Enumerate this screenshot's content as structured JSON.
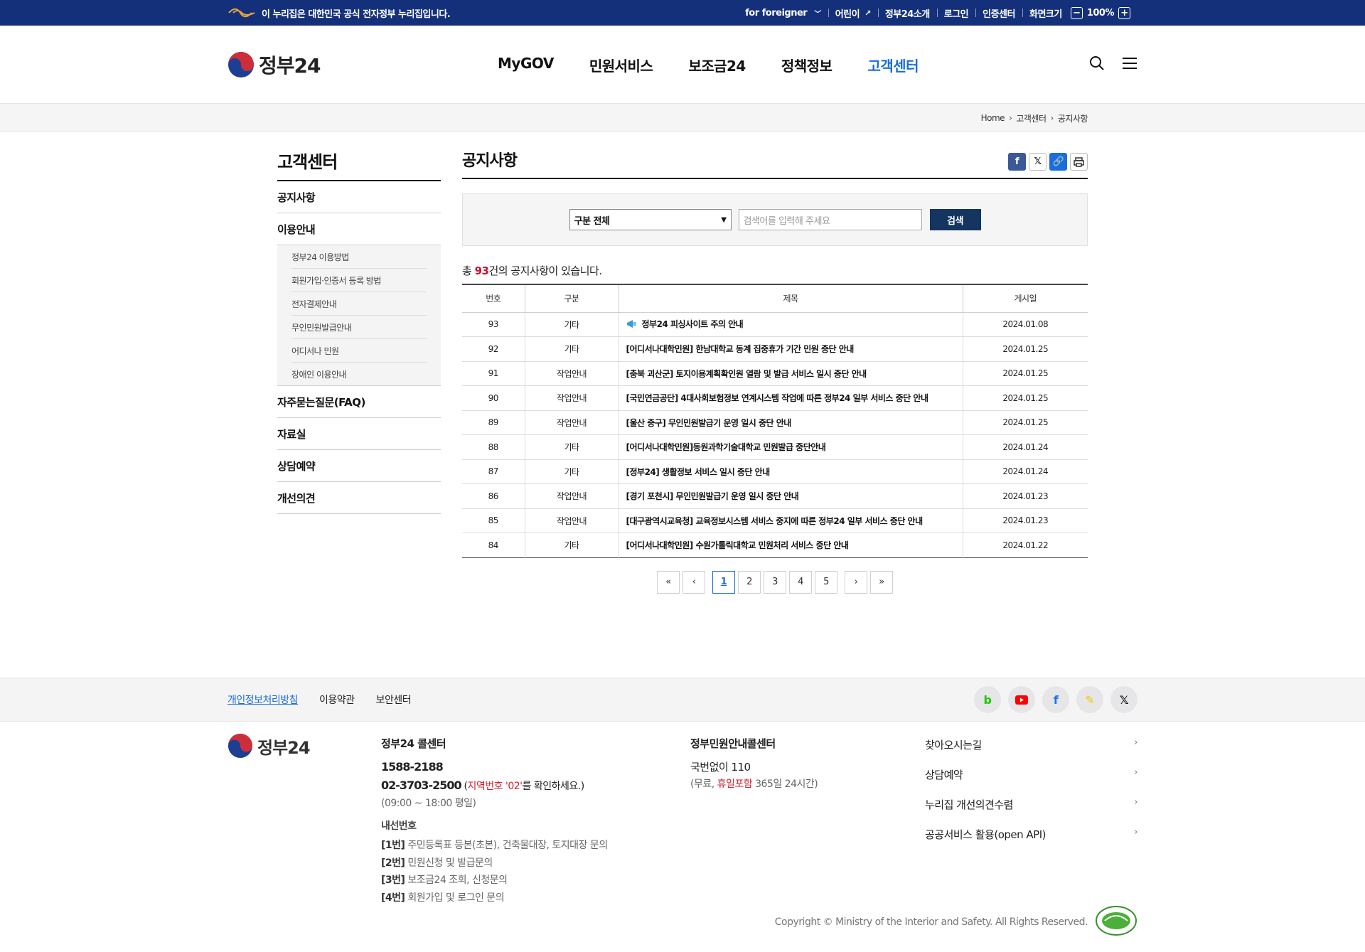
{
  "gov_bar": {
    "notice": "이 누리집은 대한민국 공식 전자정부 누리집입니다.",
    "links": [
      "for foreigner",
      "어린이",
      "정부24소개",
      "로그인",
      "인증센터",
      "화면크기"
    ],
    "zoom": "100%"
  },
  "header": {
    "logo": "정부24",
    "nav": [
      "MyGOV",
      "민원서비스",
      "보조금24",
      "정책정보",
      "고객센터"
    ]
  },
  "breadcrumb": [
    "Home",
    "고객센터",
    "공지사항"
  ],
  "lnb": {
    "title": "고객센터",
    "items": {
      "notice": "공지사항",
      "guide": "이용안내",
      "faq": "자주묻는질문(FAQ)",
      "archive": "자료실",
      "consult": "상담예약",
      "improve": "개선의견"
    },
    "sub": [
      "정부24 이용방법",
      "회원가입·인증서 등록 방법",
      "전자결제안내",
      "무인민원발급안내",
      "어디서나 민원",
      "장애인 이용안내"
    ]
  },
  "main": {
    "title": "공지사항",
    "search": {
      "select": "구분 전체",
      "placeholder": "검색어를 입력해 주세요",
      "button": "검색"
    },
    "total_prefix": "총 ",
    "total": "93",
    "total_suffix": "건의 공지사항이 있습니다.",
    "columns": [
      "번호",
      "구분",
      "제목",
      "게시일"
    ],
    "rows": [
      {
        "no": "93",
        "cat": "기타",
        "title": "정부24 피싱사이트 주의 안내",
        "date": "2024.01.08"
      },
      {
        "no": "92",
        "cat": "기타",
        "title": "[어디서나대학민원] 한남대학교 동계 집중휴가 기간 민원 중단 안내",
        "date": "2024.01.25"
      },
      {
        "no": "91",
        "cat": "작업안내",
        "title": "[충북 괴산군] 토지이용계획확인원 열람 및 발급 서비스 일시 중단 안내",
        "date": "2024.01.25"
      },
      {
        "no": "90",
        "cat": "작업안내",
        "title": "[국민연금공단] 4대사회보험정보 연계시스템 작업에 따른 정부24 일부 서비스 중단 안내",
        "date": "2024.01.25"
      },
      {
        "no": "89",
        "cat": "작업안내",
        "title": "[울산 중구] 무인민원발급기 운영 일시 중단 안내",
        "date": "2024.01.25"
      },
      {
        "no": "88",
        "cat": "기타",
        "title": "[어디서나대학민원]동원과학기술대학교 민원발급 중단안내",
        "date": "2024.01.24"
      },
      {
        "no": "87",
        "cat": "기타",
        "title": "[정부24] 생활정보 서비스 일시 중단 안내",
        "date": "2024.01.24"
      },
      {
        "no": "86",
        "cat": "작업안내",
        "title": "[경기 포천시] 무인민원발급기 운영 일시 중단 안내",
        "date": "2024.01.23"
      },
      {
        "no": "85",
        "cat": "작업안내",
        "title": "[대구광역시교육청] 교육정보시스템 서비스 중지에 따른 정부24 일부 서비스 중단 안내",
        "date": "2024.01.23"
      },
      {
        "no": "84",
        "cat": "기타",
        "title": "[어디서나대학민원] 수원가톨릭대학교 민원처리 서비스 중단 안내",
        "date": "2024.01.22"
      }
    ],
    "pages": [
      "1",
      "2",
      "3",
      "4",
      "5"
    ],
    "current_page": "1"
  },
  "footer": {
    "links": [
      "개인정보처리방침",
      "이용약관",
      "보안센터"
    ],
    "logo": "정부24",
    "call1": {
      "title": "정부24 콜센터",
      "phone1": "1588-2188",
      "phone2": "02-3703-2500",
      "phone2_note_open": " (",
      "phone2_note_red": "지역번호 '02'",
      "phone2_note_close": "를 확인하세요.)",
      "hours": "(09:00 ~ 18:00 평일)",
      "ext_title": "내선번호",
      "ext": [
        {
          "k": "[1번]",
          "v": "주민등록표 등본(초본), 건축물대장, 토지대장 문의"
        },
        {
          "k": "[2번]",
          "v": "민원신청 및 발급문의"
        },
        {
          "k": "[3번]",
          "v": "보조금24 조회, 신청문의"
        },
        {
          "k": "[4번]",
          "v": "회원가입 및 로그인 문의"
        }
      ]
    },
    "call2": {
      "title": "정부민원안내콜센터",
      "phone": "국번없이 110",
      "note_a": "(무료, ",
      "note_red": "휴일포함",
      "note_b": " 365일 24시간)"
    },
    "quick": [
      "찾아오시는길",
      "상담예약",
      "누리집 개선의견수렴",
      "공공서비스 활용(open API)"
    ],
    "copyright": "Copyright © Ministry of the Interior and Safety. All Rights Reserved."
  }
}
